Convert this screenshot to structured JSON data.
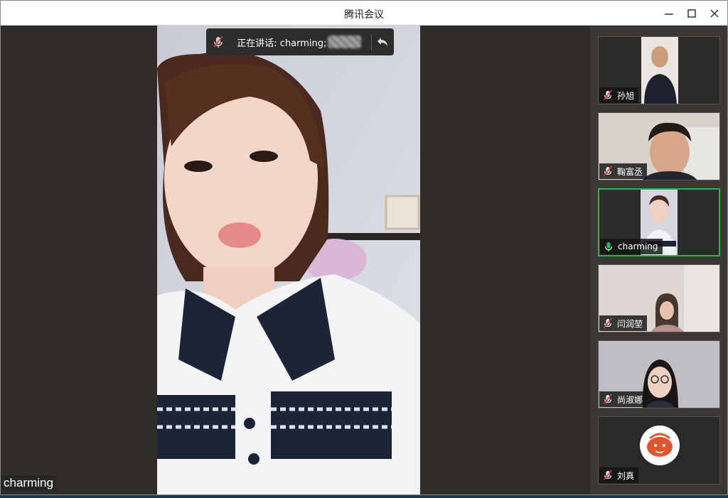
{
  "window": {
    "title": "腾讯会议",
    "controls": {
      "minimize": "minimize-icon",
      "maximize": "maximize-icon",
      "close": "close-icon"
    }
  },
  "speaking_indicator": {
    "label": "正在讲话: charming;",
    "back_icon": "back-arrow-icon"
  },
  "main_video": {
    "name_overlay": "charming"
  },
  "participants": [
    {
      "name": "孙旭",
      "mic": "muted"
    },
    {
      "name": "鞠富丞",
      "mic": "muted"
    },
    {
      "name": "charming",
      "mic": "active"
    },
    {
      "name": "闫润堃",
      "mic": "muted"
    },
    {
      "name": "尚淑娜",
      "mic": "muted"
    },
    {
      "name": "刘真",
      "mic": "muted"
    }
  ],
  "colors": {
    "active_mic": "#2fb34a",
    "muted_mic": "#e04040",
    "active_border": "#2fb34a"
  }
}
